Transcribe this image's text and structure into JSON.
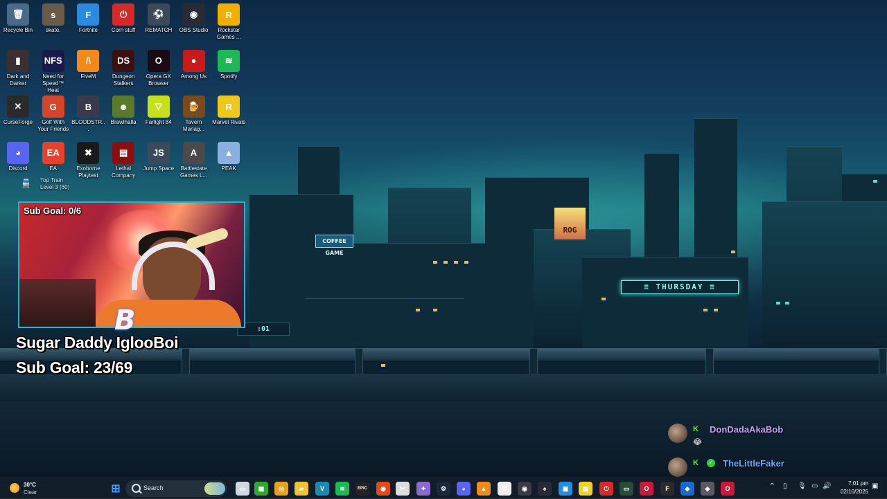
{
  "desktop": {
    "icons": [
      {
        "label": "Recycle Bin",
        "icon": "recycle-bin-icon",
        "color": "#4a6a8a",
        "glyph": "🗑"
      },
      {
        "label": "skate.",
        "icon": "skate-icon",
        "color": "#6a5a4a",
        "glyph": "s"
      },
      {
        "label": "Fortnite",
        "icon": "fortnite-icon",
        "color": "#2a8ae0",
        "glyph": "F"
      },
      {
        "label": "Corn stuff",
        "icon": "corn-stuff-icon",
        "color": "#d42a2a",
        "glyph": "⏻"
      },
      {
        "label": "REMATCH",
        "icon": "rematch-icon",
        "color": "#3a4a5a",
        "glyph": "⚽"
      },
      {
        "label": "OBS Studio",
        "icon": "obs-studio-icon",
        "color": "#2a2a36",
        "glyph": "◉"
      },
      {
        "label": "Rockstar Games ...",
        "icon": "rockstar-games-icon",
        "color": "#f0b000",
        "glyph": "R"
      },
      {
        "label": "Dark and Darker",
        "icon": "dark-and-darker-icon",
        "color": "#3a3030",
        "glyph": "▮"
      },
      {
        "label": "Need for Speed™ Heat",
        "icon": "nfs-heat-icon",
        "color": "#1a1a4a",
        "glyph": "NFS"
      },
      {
        "label": "FiveM",
        "icon": "fivem-icon",
        "color": "#f28a1a",
        "glyph": "/\\"
      },
      {
        "label": "Dungeon Stalkers",
        "icon": "dungeon-stalkers-icon",
        "color": "#3a1010",
        "glyph": "DS"
      },
      {
        "label": "Opera GX Browser",
        "icon": "opera-gx-icon",
        "color": "#1a0a14",
        "glyph": "O"
      },
      {
        "label": "Among Us",
        "icon": "among-us-icon",
        "color": "#c81a1a",
        "glyph": "●"
      },
      {
        "label": "Spotify",
        "icon": "spotify-icon",
        "color": "#1db954",
        "glyph": "≋"
      },
      {
        "label": "CurseForge",
        "icon": "curseforge-icon",
        "color": "#2a2a2a",
        "glyph": "✕"
      },
      {
        "label": "Golf With Your Friends",
        "icon": "golf-with-your-friends-icon",
        "color": "#d8442a",
        "glyph": "G"
      },
      {
        "label": "BLOODSTR...",
        "icon": "bloodstrike-icon",
        "color": "#3a3a4a",
        "glyph": "B"
      },
      {
        "label": "Brawlhalla",
        "icon": "brawlhalla-icon",
        "color": "#5a7a2a",
        "glyph": "☻"
      },
      {
        "label": "Farlight 84",
        "icon": "farlight-84-icon",
        "color": "#c8e01a",
        "glyph": "▽"
      },
      {
        "label": "Tavern Manag...",
        "icon": "tavern-manager-icon",
        "color": "#7a4a1a",
        "glyph": "🍺"
      },
      {
        "label": "Marvel Rivals",
        "icon": "marvel-rivals-icon",
        "color": "#f0c81a",
        "glyph": "R"
      },
      {
        "label": "Discord",
        "icon": "discord-icon",
        "color": "#5865f2",
        "glyph": "◕"
      },
      {
        "label": "EA",
        "icon": "ea-icon",
        "color": "#e8402a",
        "glyph": "EA"
      },
      {
        "label": "Exoborne Playtest",
        "icon": "exoborne-icon",
        "color": "#1a1a1a",
        "glyph": "✖"
      },
      {
        "label": "Lethal Company",
        "icon": "lethal-company-icon",
        "color": "#8a1010",
        "glyph": "▤"
      },
      {
        "label": "Jump Space",
        "icon": "jump-space-icon",
        "color": "#3a4a5a",
        "glyph": "JS"
      },
      {
        "label": "Battlestate Games L...",
        "icon": "battlestate-games-icon",
        "color": "#4a4a4a",
        "glyph": "A"
      },
      {
        "label": "PEAK",
        "icon": "peak-icon",
        "color": "#8ab0e0",
        "glyph": "▲"
      }
    ],
    "toptrain": {
      "line1": "Top Train",
      "line2": "Level 3 (60)",
      "icon": "train-icon"
    }
  },
  "stream": {
    "cam_goal": "Sub Goal: 0/6",
    "overlay_line1": "Sugar Daddy IglooBoi",
    "overlay_line2": "Sub Goal: 23/69",
    "cam_logo": "B"
  },
  "wallpaper": {
    "sign_thursday": "≡ THURSDAY ≡",
    "sign_rog": "ROG",
    "sign_coffee": "COFFEE GAME",
    "sign_ticker": ":01"
  },
  "chat": [
    {
      "badge": "K",
      "name": "DonDadaAkaBob",
      "color": "#c7a0f0",
      "emoji": "😂"
    },
    {
      "badge": "K",
      "name": "TheLittleFaker",
      "color": "#6aa8ff",
      "emoji": ""
    }
  ],
  "taskbar": {
    "weather": {
      "temp": "30°C",
      "condition": "Clear"
    },
    "search_placeholder": "Search",
    "apps": [
      {
        "name": "start-icon",
        "glyph": "⊞",
        "color": "#3aa0ff"
      },
      {
        "name": "task-view-icon",
        "glyph": "▭",
        "color": "#d0d8e0"
      },
      {
        "name": "xbox-icon",
        "glyph": "▦",
        "color": "#2ea82e"
      },
      {
        "name": "chrome-icon",
        "glyph": "◎",
        "color": "#e8a020"
      },
      {
        "name": "file-explorer-icon",
        "glyph": "▰",
        "color": "#f2c230"
      },
      {
        "name": "vegas-icon",
        "glyph": "V",
        "color": "#1a8ab0"
      },
      {
        "name": "spotify-icon",
        "glyph": "≋",
        "color": "#1db954"
      },
      {
        "name": "epic-games-icon",
        "glyph": "EPIC",
        "color": "#222"
      },
      {
        "name": "browser-icon",
        "glyph": "◉",
        "color": "#e24a1a"
      },
      {
        "name": "capcut-icon",
        "glyph": "✂",
        "color": "#ddd"
      },
      {
        "name": "copilot-icon",
        "glyph": "✦",
        "color": "#8a6ad0"
      },
      {
        "name": "steam-icon",
        "glyph": "⚙",
        "color": "#1b2838"
      },
      {
        "name": "discord-icon",
        "glyph": "◕",
        "color": "#5865f2"
      },
      {
        "name": "vlc-icon",
        "glyph": "▲",
        "color": "#f28a1a"
      },
      {
        "name": "capcut-app-icon",
        "glyph": "✖",
        "color": "#eee"
      },
      {
        "name": "obs-icon",
        "glyph": "◉",
        "color": "#3a3a46"
      },
      {
        "name": "game-icon",
        "glyph": "♠",
        "color": "#2a2a36"
      },
      {
        "name": "photos-icon",
        "glyph": "▣",
        "color": "#2a8ae0"
      },
      {
        "name": "sticky-notes-icon",
        "glyph": "▤",
        "color": "#f2d22a"
      },
      {
        "name": "power-icon",
        "glyph": "⏻",
        "color": "#d42a2a"
      },
      {
        "name": "terminal-icon",
        "glyph": "▭",
        "color": "#2a4a3a"
      },
      {
        "name": "opera-gx-icon",
        "glyph": "O",
        "color": "#c81a3a"
      },
      {
        "name": "fl-studio-icon",
        "glyph": "F",
        "color": "#2a2a2a"
      },
      {
        "name": "vscode-icon",
        "glyph": "◆",
        "color": "#1a6ad0"
      },
      {
        "name": "rog-icon",
        "glyph": "◈",
        "color": "#5a5a66"
      },
      {
        "name": "opera-gx-2-icon",
        "glyph": "O",
        "color": "#c81a3a"
      }
    ],
    "tray": {
      "chevron": "^",
      "clock_time": "7:01 pm",
      "clock_date": "02/10/2025"
    }
  }
}
